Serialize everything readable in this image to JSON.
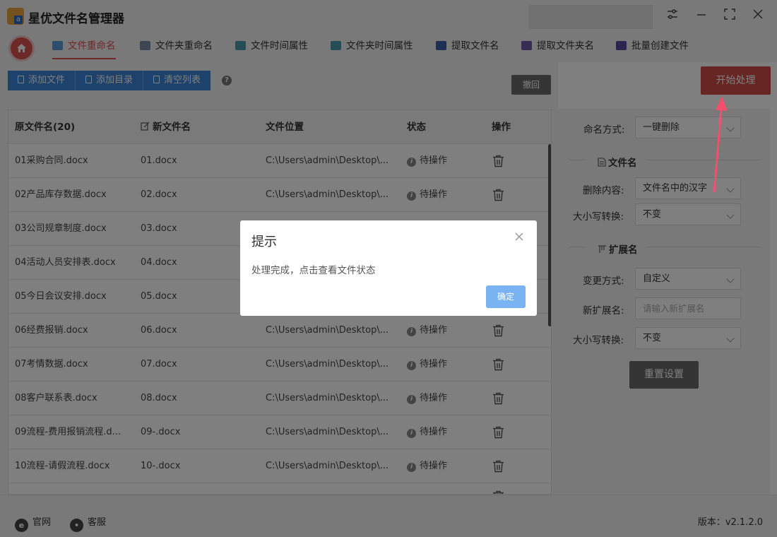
{
  "app": {
    "title": "星优文件名管理器",
    "accent": "#d9534f"
  },
  "tabs": [
    {
      "label": "文件重命名",
      "active": true,
      "icon": "file-rename-icon"
    },
    {
      "label": "文件夹重命名",
      "active": false,
      "icon": "folder-rename-icon"
    },
    {
      "label": "文件时间属性",
      "active": false,
      "icon": "file-time-icon"
    },
    {
      "label": "文件夹时间属性",
      "active": false,
      "icon": "folder-time-icon"
    },
    {
      "label": "提取文件名",
      "active": false,
      "icon": "extract-filename-icon"
    },
    {
      "label": "提取文件夹名",
      "active": false,
      "icon": "extract-foldername-icon"
    },
    {
      "label": "批量创建文件",
      "active": false,
      "icon": "batch-create-icon"
    }
  ],
  "toolbar": {
    "add_file": "添加文件",
    "add_dir": "添加目录",
    "clear_list": "清空列表",
    "help": "?",
    "undo": "撤回"
  },
  "table": {
    "columns": {
      "original": "原文件名(20)",
      "new": "新文件名",
      "location": "文件位置",
      "status": "状态",
      "action": "操作"
    },
    "rows": [
      {
        "original": "01采购合同.docx",
        "new": "01.docx",
        "location": "C:\\Users\\admin\\Desktop\\...",
        "status": "待操作"
      },
      {
        "original": "02产品库存数据.docx",
        "new": "02.docx",
        "location": "C:\\Users\\admin\\Desktop\\...",
        "status": "待操作"
      },
      {
        "original": "03公司规章制度.docx",
        "new": "03.docx",
        "location": "",
        "status": ""
      },
      {
        "original": "04活动人员安排表.docx",
        "new": "04.docx",
        "location": "",
        "status": ""
      },
      {
        "original": "05今日会议安排.docx",
        "new": "05.docx",
        "location": "",
        "status": ""
      },
      {
        "original": "06经费报销.docx",
        "new": "06.docx",
        "location": "C:\\Users\\admin\\Desktop\\...",
        "status": "待操作"
      },
      {
        "original": "07考情数据.docx",
        "new": "07.docx",
        "location": "C:\\Users\\admin\\Desktop\\...",
        "status": "待操作"
      },
      {
        "original": "08客户联系表.docx",
        "new": "08.docx",
        "location": "C:\\Users\\admin\\Desktop\\...",
        "status": "待操作"
      },
      {
        "original": "09流程-费用报销流程.d...",
        "new": "09-.docx",
        "location": "C:\\Users\\admin\\Desktop\\...",
        "status": "待操作"
      },
      {
        "original": "10流程-请假流程.docx",
        "new": "10-.docx",
        "location": "C:\\Users\\admin\\Desktop\\...",
        "status": "待操作"
      }
    ]
  },
  "panel": {
    "start_button": "开始处理",
    "naming_mode_label": "命名方式:",
    "naming_mode_value": "一键删除",
    "filename_section": "文件名",
    "delete_content_label": "删除内容:",
    "delete_content_value": "文件名中的汉字",
    "case1_label": "大小写转换:",
    "case1_value": "不变",
    "ext_section": "扩展名",
    "change_mode_label": "变更方式:",
    "change_mode_value": "自定义",
    "new_ext_label": "新扩展名:",
    "new_ext_placeholder": "请输入新扩展名",
    "case2_label": "大小写转换:",
    "case2_value": "不变",
    "reset_button": "重置设置"
  },
  "footer": {
    "website": "官网",
    "support": "客服",
    "version": "版本：v2.1.2.0"
  },
  "dialog": {
    "title": "提示",
    "message": "处理完成，点击查看文件状态",
    "ok": "确定"
  }
}
